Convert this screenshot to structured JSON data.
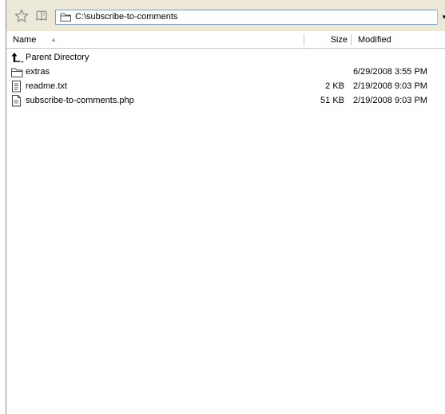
{
  "address_bar": {
    "path": "C:\\subscribe-to-comments",
    "dropdown_glyph": "▾"
  },
  "icons": {
    "bookmark": "star-icon",
    "history": "book-icon",
    "folder": "folder-icon",
    "parent": "up-arrow-icon",
    "text_file": "text-file-icon",
    "php_file": "php-file-icon"
  },
  "columns": {
    "name": "Name",
    "sort_indicator": "▲",
    "size": "Size",
    "modified": "Modified"
  },
  "files": [
    {
      "name": "Parent Directory",
      "size": "",
      "modified": "",
      "icon": "up-arrow-icon"
    },
    {
      "name": "extras",
      "size": "",
      "modified": "6/29/2008 3:55 PM",
      "icon": "folder-icon"
    },
    {
      "name": "readme.txt",
      "size": "2 KB",
      "modified": "2/19/2008 9:03 PM",
      "icon": "text-file-icon"
    },
    {
      "name": "subscribe-to-comments.php",
      "size": "51 KB",
      "modified": "2/19/2008 9:03 PM",
      "icon": "php-file-icon"
    }
  ],
  "colors": {
    "toolbar_bg": "#ece9d8",
    "address_border": "#7f9db9"
  }
}
